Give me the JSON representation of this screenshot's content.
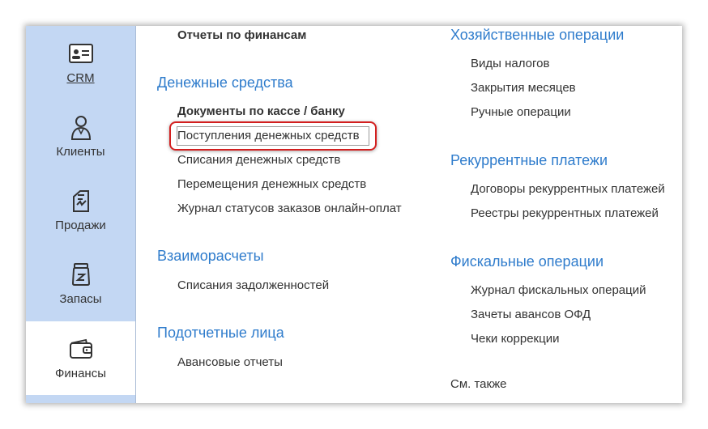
{
  "sidebar": {
    "items": [
      {
        "label": "CRM",
        "icon": "id-card-icon"
      },
      {
        "label": "Клиенты",
        "icon": "person-icon"
      },
      {
        "label": "Продажи",
        "icon": "sales-icon"
      },
      {
        "label": "Запасы",
        "icon": "stock-jar-icon"
      },
      {
        "label": "Финансы",
        "icon": "wallet-icon"
      }
    ]
  },
  "left_column": {
    "top_link": "Отчеты по финансам",
    "cash": {
      "title": "Денежные средства",
      "subheader": "Документы по кассе / банку",
      "links": [
        "Поступления денежных средств",
        "Списания денежных средств",
        "Перемещения денежных средств",
        "Журнал статусов заказов онлайн-оплат"
      ]
    },
    "settlements": {
      "title": "Взаиморасчеты",
      "links": [
        "Списания задолженностей"
      ]
    },
    "accountable": {
      "title": "Подотчетные лица",
      "links": [
        "Авансовые отчеты"
      ]
    }
  },
  "right_column": {
    "business": {
      "title": "Хозяйственные операции",
      "links": [
        "Виды налогов",
        "Закрытия месяцев",
        "Ручные операции"
      ]
    },
    "recurring": {
      "title": "Рекуррентные платежи",
      "links": [
        "Договоры рекуррентных платежей",
        "Реестры рекуррентных платежей"
      ]
    },
    "fiscal": {
      "title": "Фискальные операции",
      "links": [
        "Журнал фискальных операций",
        "Зачеты авансов ОФД",
        "Чеки коррекции"
      ]
    },
    "see_also": "См. также"
  },
  "colors": {
    "sidebar_bg": "#c3d7f3",
    "section_title": "#2f7ccc",
    "highlight_border": "#d31f1f"
  }
}
